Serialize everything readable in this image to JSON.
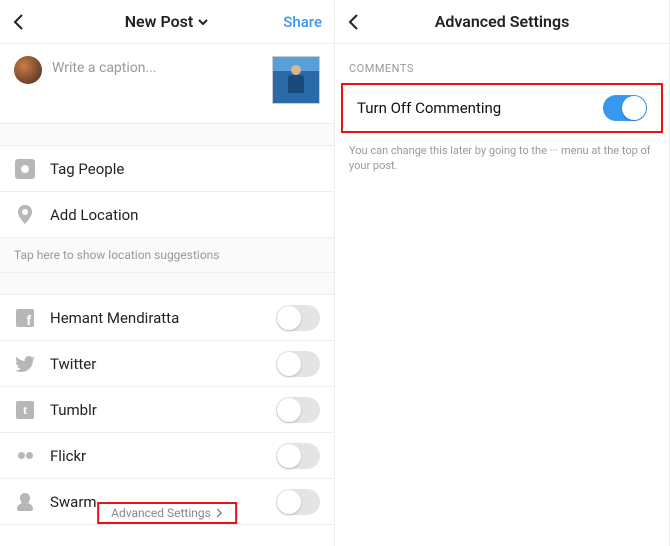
{
  "left": {
    "title": "New Post",
    "share": "Share",
    "caption_placeholder": "Write a caption...",
    "tag_people": "Tag People",
    "add_location": "Add Location",
    "location_hint": "Tap here to show location suggestions",
    "shares": [
      {
        "label": "Hemant Mendiratta"
      },
      {
        "label": "Twitter"
      },
      {
        "label": "Tumblr"
      },
      {
        "label": "Flickr"
      },
      {
        "label": "Swarm"
      }
    ],
    "advanced": "Advanced Settings"
  },
  "right": {
    "title": "Advanced Settings",
    "section": "COMMENTS",
    "toggle_label": "Turn Off Commenting",
    "hint": "You can change this later by going to the ··· menu at the top of your post."
  }
}
